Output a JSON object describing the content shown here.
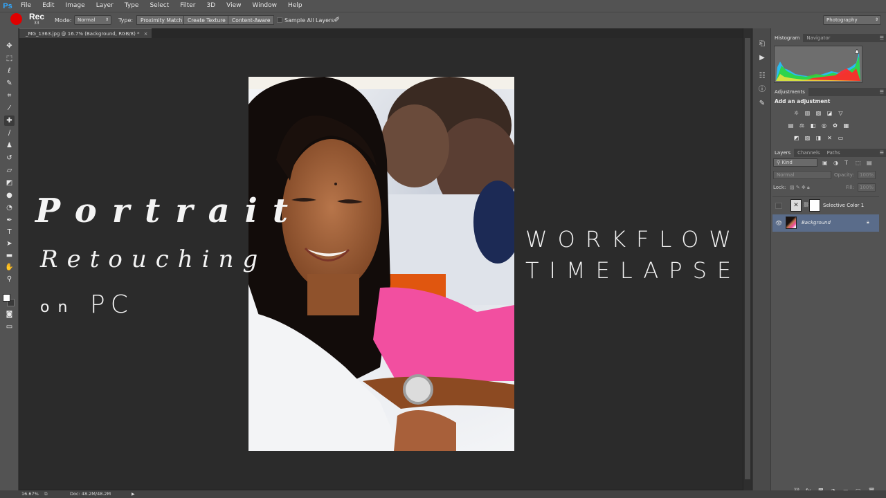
{
  "app": {
    "logo": "Ps",
    "menu": [
      "File",
      "Edit",
      "Image",
      "Layer",
      "Type",
      "Select",
      "Filter",
      "3D",
      "View",
      "Window",
      "Help"
    ]
  },
  "options": {
    "rec_text": "Rec",
    "brush_size": "33",
    "mode_label": "Mode:",
    "mode_value": "Normal",
    "type_label": "Type:",
    "type_options": [
      "Proximity Match",
      "Create Texture",
      "Content-Aware"
    ],
    "sample_all_label": "Sample All Layers",
    "workspace": "Photography"
  },
  "document": {
    "tab_title": "_MG_1363.jpg @ 16.7% (Background, RGB/8) *",
    "tab_close": "×"
  },
  "overlay_text": {
    "portrait": "Portrait",
    "retouching": "Retouching",
    "on": "on",
    "pc": "PC",
    "workflow": "WORKFLOW",
    "timelapse": "TIMELAPSE"
  },
  "panels": {
    "histogram_tabs": [
      "Histogram",
      "Navigator"
    ],
    "adjustments_tab": "Adjustments",
    "adjustments_title": "Add an adjustment",
    "layers_tabs": [
      "Layers",
      "Channels",
      "Paths"
    ],
    "kind_label": "Kind",
    "blend_mode": "Normal",
    "opacity_label": "Opacity:",
    "opacity_value": "100%",
    "lock_label": "Lock:",
    "fill_label": "Fill:",
    "fill_value": "100%",
    "layers": [
      {
        "name": "Selective Color 1"
      },
      {
        "name": "Background"
      }
    ]
  },
  "status": {
    "zoom": "16.67%",
    "doc": "Doc: 48.2M/48.2M"
  },
  "colors": {
    "accent_blue": "#31a8ff",
    "rec_red": "#e00000",
    "selected_layer": "#5a6c8a",
    "pink_shirt": "#f24fa0"
  }
}
